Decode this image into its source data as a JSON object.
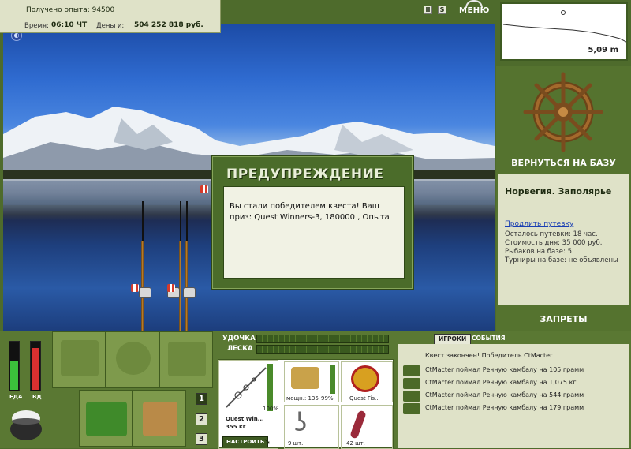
{
  "info": {
    "exp_label": "Получено опыта: 94500",
    "time_label": "Время:",
    "time_value": "06:10 ЧТ",
    "money_label": "Деньги:",
    "money_value": "504 252 818 руб."
  },
  "controls": {
    "pause": "II",
    "sound": "S",
    "menu": "МЕНЮ"
  },
  "depth": {
    "value": "5,09 m"
  },
  "right_panel": {
    "back_to_base": "ВЕРНУТЬСЯ НА БАЗУ",
    "location_title": "Норвегия. Заполярье",
    "extend_link": "Продлить путевку",
    "remaining": "Осталось путевки: 18 час.",
    "day_cost": "Стоимость дня: 35 000 руб.",
    "fishers": "Рыбаков на базе: 5",
    "tournaments": "Турниры на базе: не объявлены",
    "bans": "ЗАПРЕТЫ"
  },
  "dialog": {
    "title": "ПРЕДУПРЕЖДЕНИЕ",
    "message": "Вы стали победителем квеста! Ваш приз: Quest Winners-3, 180000 , Опыта"
  },
  "meters": {
    "food_label": "ЕДА",
    "vodka_label": "ВД",
    "food_level": 0.62,
    "vodka_level": 0.88
  },
  "pages": [
    "1",
    "2",
    "3"
  ],
  "tackle": {
    "rod_label": "УДОЧКА",
    "line_label": "ЛЕСКА"
  },
  "equipment": {
    "rod_name": "Quest Win...",
    "rod_weight": "355 кг",
    "rod_percent": "100%",
    "reel_label": "мощн.: 135",
    "reel_percent": "99%",
    "line_name": "Quest Fis...",
    "hook_count": "9 шт.",
    "bait_count": "42 шт.",
    "setup_button": "НАСТРОИТЬ"
  },
  "chat": {
    "tab_players": "ИГРОКИ",
    "tab_events": "СОБЫТИЯ",
    "lines": [
      "Квест закончен! Победитель CtMacter",
      "CtMacter поймал Речную камбалу на 105 грамм",
      "CtMacter поймал Речную камбалу на 1,075 кг",
      "CtMacter поймал Речную камбалу на 544 грамм",
      "CtMacter поймал Речную камбалу на 179 грамм"
    ]
  },
  "colors": {
    "panel_green": "#55732f",
    "panel_light": "#dfe2c8",
    "link_blue": "#1a3fb3",
    "food_green": "#3bbf3b",
    "vodka_red": "#d83030"
  }
}
